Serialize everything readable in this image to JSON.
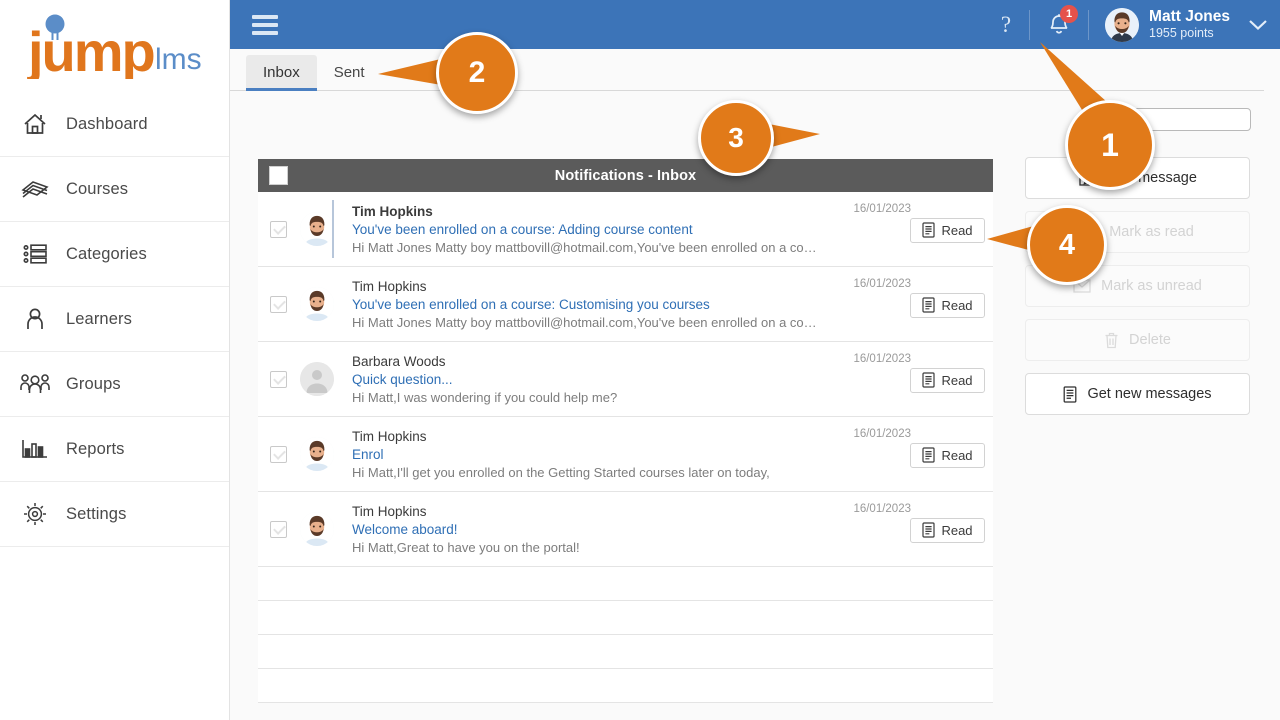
{
  "brand": {
    "name_primary": "jump",
    "name_secondary": "lms",
    "primary_color": "#e0761d",
    "secondary_color": "#5b8dc8"
  },
  "sidebar": {
    "items": [
      {
        "label": "Dashboard",
        "icon": "home-icon"
      },
      {
        "label": "Courses",
        "icon": "books-icon"
      },
      {
        "label": "Categories",
        "icon": "list-icon"
      },
      {
        "label": "Learners",
        "icon": "user-icon"
      },
      {
        "label": "Groups",
        "icon": "users-icon"
      },
      {
        "label": "Reports",
        "icon": "bar-chart-icon"
      },
      {
        "label": "Settings",
        "icon": "gear-icon"
      }
    ]
  },
  "topbar": {
    "menu_icon": "hamburger-icon",
    "help_icon": "question-mark-icon",
    "bell_icon": "bell-icon",
    "notification_count": "1",
    "user_name": "Matt Jones",
    "user_points": "1955 points",
    "caret_icon": "chevron-down-icon",
    "background_color": "#3c74b8"
  },
  "tabs": [
    {
      "label": "Inbox",
      "active": true
    },
    {
      "label": "Sent",
      "active": false
    }
  ],
  "search": {
    "value": "",
    "placeholder": "",
    "icon": "search-icon"
  },
  "list": {
    "header_title": "Notifications - Inbox",
    "header_checkbox_icon": "checkbox-icon",
    "read_button_label": "Read",
    "read_button_icon": "document-icon",
    "messages": [
      {
        "sender": "Tim Hopkins",
        "subject": "You've been enrolled on a course: Adding course content",
        "preview": "Hi Matt Jones Matty boy mattbovill@hotmail.com,You've been enrolled on a course:Ad...",
        "date": "16/01/2023",
        "unread": true,
        "avatar": "man-beard-avatar"
      },
      {
        "sender": "Tim Hopkins",
        "subject": "You've been enrolled on a course: Customising you courses",
        "preview": "Hi Matt Jones Matty boy mattbovill@hotmail.com,You've been enrolled on a course:Cus...",
        "date": "16/01/2023",
        "unread": false,
        "avatar": "man-beard-avatar"
      },
      {
        "sender": "Barbara Woods",
        "subject": "Quick question...",
        "preview": "Hi Matt,I was wondering if you could help me?",
        "date": "16/01/2023",
        "unread": false,
        "avatar": "placeholder-avatar"
      },
      {
        "sender": "Tim Hopkins",
        "subject": "Enrol",
        "preview": "Hi Matt,I'll get you enrolled on the Getting Started courses later on today,",
        "date": "16/01/2023",
        "unread": false,
        "avatar": "man-beard-avatar"
      },
      {
        "sender": "Tim Hopkins",
        "subject": "Welcome aboard!",
        "preview": "Hi Matt,Great to have you on the portal!",
        "date": "16/01/2023",
        "unread": false,
        "avatar": "man-beard-avatar"
      }
    ],
    "empty_rows": 4
  },
  "actions": [
    {
      "label": "New message",
      "icon": "compose-icon",
      "disabled": false
    },
    {
      "label": "Mark as read",
      "icon": "open-envelope-icon",
      "disabled": true
    },
    {
      "label": "Mark as unread",
      "icon": "closed-envelope-icon",
      "disabled": true
    },
    {
      "label": "Delete",
      "icon": "trash-icon",
      "disabled": true
    },
    {
      "label": "Get new messages",
      "icon": "document-icon",
      "disabled": false
    }
  ],
  "callouts": [
    {
      "number": "1"
    },
    {
      "number": "2"
    },
    {
      "number": "3"
    },
    {
      "number": "4"
    }
  ]
}
